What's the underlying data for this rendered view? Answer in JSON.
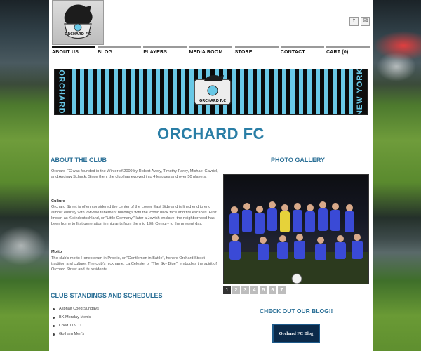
{
  "social": {
    "facebook": "f",
    "mail": "✉"
  },
  "nav": [
    {
      "label": "ABOUT US"
    },
    {
      "label": "BLOG"
    },
    {
      "label": "PLAYERS"
    },
    {
      "label": "MEDIA ROOM"
    },
    {
      "label": "STORE"
    },
    {
      "label": "CONTACT"
    },
    {
      "label": "CART (0)"
    }
  ],
  "banner": {
    "left_text": "ORCHARD",
    "right_text": "NEW YORK",
    "crest_text": "ORCHARD F.C"
  },
  "logo": {
    "text": "ORCHARD F.C"
  },
  "page_title": "ORCHARD FC",
  "about": {
    "heading": "About the Club",
    "intro": "Orchard FC was founded in the Winter of 2009 by Robert Avery, Timothy Farey, Michael Gavriel, and Andrew Schuck. Since then, the club has evolved into 4 leagues and over 50 players.",
    "culture_heading": "Culture",
    "culture": "Orchard Street is often considered the center of the Lower East Side and is lined end to end almost entirely with low-rise tenement buildings with the iconic brick face and fire escapes. First known as Kleindeutschland, or \"Little Germany,\" later a Jewish enclave, the neighborhood has been home to first generation immigrants from the mid 19th Century to the present day.",
    "motto_heading": "Motto",
    "motto": "The club's motto Honestorum in Proelio, or \"Gentlemen in Battle\", honors Orchard Street tradition and culture. The club's nickname, La Celeste, or \"The Sky Blue\", embodies the spirit of Orchard Street and its residents."
  },
  "gallery": {
    "heading": "PHOTO GALLERY",
    "pages": [
      "1",
      "2",
      "3",
      "4",
      "5",
      "6",
      "7"
    ],
    "current_page": "1"
  },
  "standings": {
    "heading": "Club Standings and Schedules",
    "items": [
      "Asphalt Coed Sundays",
      "BK Monday Men's",
      "Coed 11 v 11",
      "Gotham Men's"
    ]
  },
  "blog": {
    "heading": "CHECK OUT OUR BLOG!!",
    "button_label": "Orchard FC Blog"
  },
  "colors": {
    "accent": "#2a7ea6",
    "stripe_blue": "#69c8e6",
    "stripe_black": "#0a0a0a",
    "blog_button": "#0b2a4a"
  }
}
